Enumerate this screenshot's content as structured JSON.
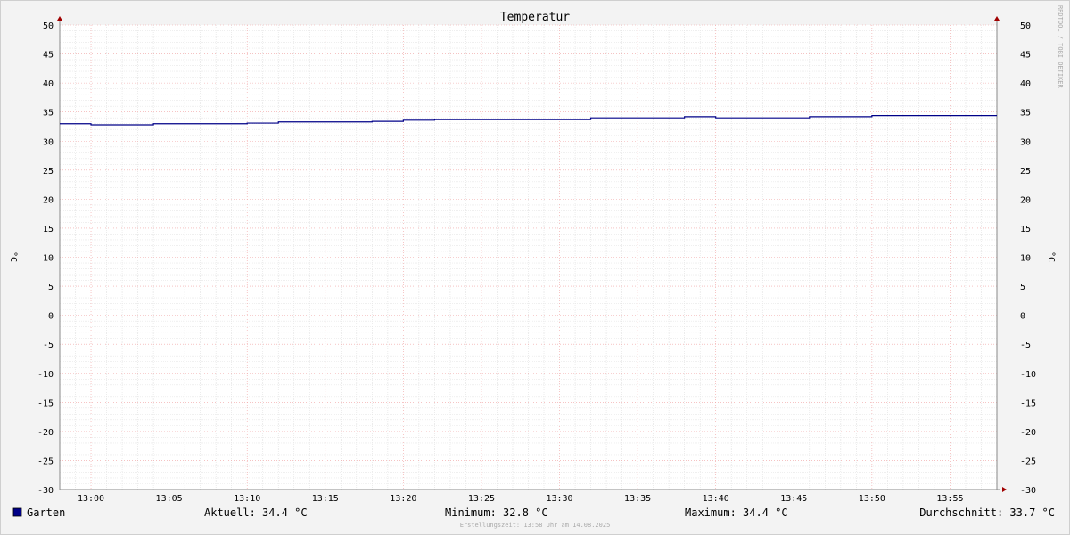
{
  "chart_data": {
    "type": "line",
    "title": "Temperatur",
    "ylabel": "°C",
    "ylabel_right": "°C",
    "ylim": [
      -30,
      50
    ],
    "yticks": [
      50,
      45,
      40,
      35,
      30,
      25,
      20,
      15,
      10,
      5,
      0,
      -5,
      -10,
      -15,
      -20,
      -25,
      -30
    ],
    "xlim": [
      "12:58",
      "13:58"
    ],
    "xticks": [
      "13:00",
      "13:05",
      "13:10",
      "13:15",
      "13:20",
      "13:25",
      "13:30",
      "13:35",
      "13:40",
      "13:45",
      "13:50",
      "13:55"
    ],
    "grid": true,
    "series": [
      {
        "name": "Garten",
        "color": "#000088",
        "x": [
          "12:58",
          "13:00",
          "13:04",
          "13:10",
          "13:12",
          "13:18",
          "13:20",
          "13:22",
          "13:32",
          "13:38",
          "13:40",
          "13:46",
          "13:50",
          "13:58"
        ],
        "values": [
          33.0,
          32.8,
          33.0,
          33.1,
          33.3,
          33.4,
          33.6,
          33.7,
          34.0,
          34.2,
          34.0,
          34.2,
          34.4,
          34.4
        ]
      }
    ],
    "legend_position": "bottom"
  },
  "legend": {
    "series_name": "Garten",
    "series_color": "#000088",
    "current": "Aktuell: 34.4 °C",
    "minimum": "Minimum: 32.8 °C",
    "maximum": "Maximum: 34.4 °C",
    "average": "Durchschnitt: 33.7 °C"
  },
  "footer": {
    "created": "Erstellungszeit: 13:58 Uhr am 14.08.2025"
  },
  "watermark": "RRDTOOL / TOBI OETIKER"
}
